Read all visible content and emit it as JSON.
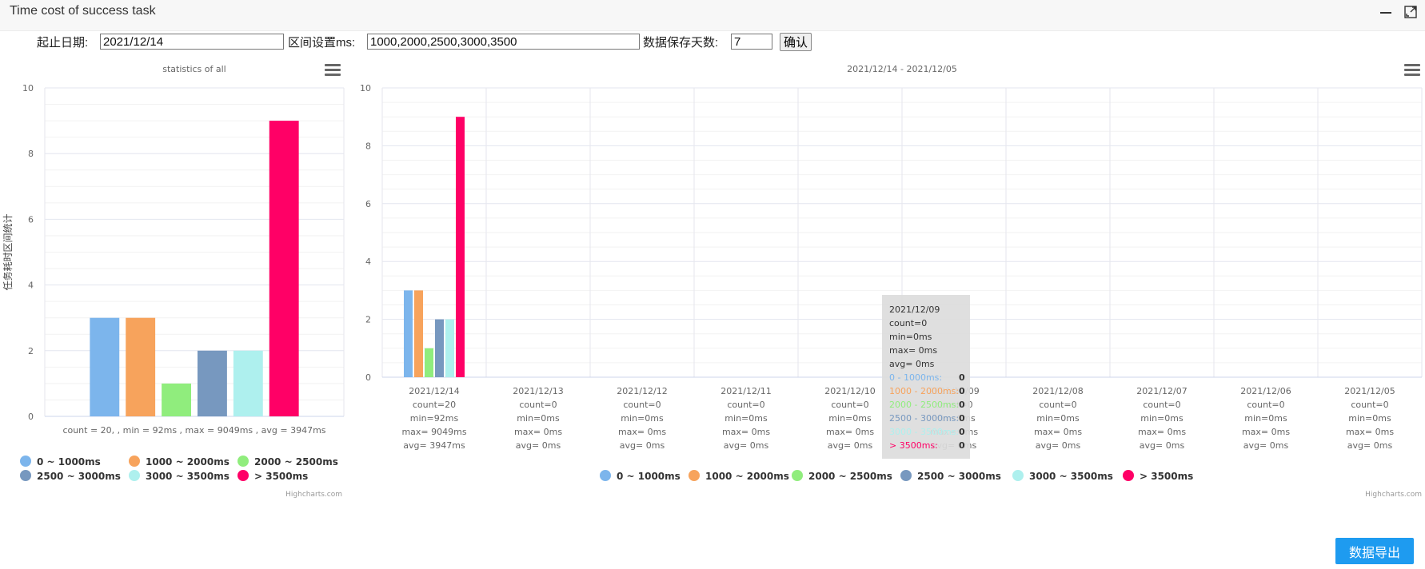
{
  "window": {
    "title": "Time cost of success task"
  },
  "filters": {
    "date_label": "起止日期:",
    "date_value": "2021/12/14",
    "interval_label": "区间设置ms:",
    "interval_value": "1000,2000,2500,3000,3500",
    "days_label": "数据保存天数:",
    "days_value": "7",
    "confirm_label": "确认"
  },
  "export_label": "数据导出",
  "colors": {
    "s0": "#7cb5ec",
    "s1": "#f7a35c",
    "s2": "#90ed7d",
    "s3": "#8085e9",
    "s4": "#aef0ee",
    "s5": "#ff0066"
  },
  "legend": [
    "0 ~ 1000ms",
    "1000 ~ 2000ms",
    "2000 ~ 2500ms",
    "2500 ~ 3000ms",
    "3000 ~ 3500ms",
    "> 3500ms"
  ],
  "credits": "Highcharts.com",
  "chart_data": [
    {
      "type": "bar",
      "title": "statistics of all",
      "ylabel": "任务耗时区间统计",
      "ylim": [
        0,
        10
      ],
      "yticks": [
        0,
        2,
        4,
        6,
        8,
        10
      ],
      "categories": [
        "count = 20, , min = 92ms , max = 9049ms , avg = 3947ms"
      ],
      "series": [
        {
          "name": "0 ~ 1000ms",
          "values": [
            3
          ]
        },
        {
          "name": "1000 ~ 2000ms",
          "values": [
            3
          ]
        },
        {
          "name": "2000 ~ 2500ms",
          "values": [
            1
          ]
        },
        {
          "name": "2500 ~ 3000ms",
          "values": [
            2
          ]
        },
        {
          "name": "3000 ~ 3500ms",
          "values": [
            2
          ]
        },
        {
          "name": "> 3500ms",
          "values": [
            9
          ]
        }
      ],
      "grid": true,
      "legend": "bottom"
    },
    {
      "type": "bar",
      "title": "2021/12/14 - 2021/12/05",
      "ylim": [
        0,
        10
      ],
      "yticks": [
        0,
        2,
        4,
        6,
        8,
        10
      ],
      "categories": [
        {
          "date": "2021/12/14",
          "count": "count=20",
          "min": "min=92ms",
          "max": "max= 9049ms",
          "avg": "avg= 3947ms"
        },
        {
          "date": "2021/12/13",
          "count": "count=0",
          "min": "min=0ms",
          "max": "max= 0ms",
          "avg": "avg= 0ms"
        },
        {
          "date": "2021/12/12",
          "count": "count=0",
          "min": "min=0ms",
          "max": "max= 0ms",
          "avg": "avg= 0ms"
        },
        {
          "date": "2021/12/11",
          "count": "count=0",
          "min": "min=0ms",
          "max": "max= 0ms",
          "avg": "avg= 0ms"
        },
        {
          "date": "2021/12/10",
          "count": "count=0",
          "min": "min=0ms",
          "max": "max= 0ms",
          "avg": "avg= 0ms"
        },
        {
          "date": "2021/12/09",
          "count": "count=0",
          "min": "min=0ms",
          "max": "max= 0ms",
          "avg": "avg= 0ms"
        },
        {
          "date": "2021/12/08",
          "count": "count=0",
          "min": "min=0ms",
          "max": "max= 0ms",
          "avg": "avg= 0ms"
        },
        {
          "date": "2021/12/07",
          "count": "count=0",
          "min": "min=0ms",
          "max": "max= 0ms",
          "avg": "avg= 0ms"
        },
        {
          "date": "2021/12/06",
          "count": "count=0",
          "min": "min=0ms",
          "max": "max= 0ms",
          "avg": "avg= 0ms"
        },
        {
          "date": "2021/12/05",
          "count": "count=0",
          "min": "min=0ms",
          "max": "max= 0ms",
          "avg": "avg= 0ms"
        }
      ],
      "series": [
        {
          "name": "0 ~ 1000ms",
          "values": [
            3,
            0,
            0,
            0,
            0,
            0,
            0,
            0,
            0,
            0
          ]
        },
        {
          "name": "1000 ~ 2000ms",
          "values": [
            3,
            0,
            0,
            0,
            0,
            0,
            0,
            0,
            0,
            0
          ]
        },
        {
          "name": "2000 ~ 2500ms",
          "values": [
            1,
            0,
            0,
            0,
            0,
            0,
            0,
            0,
            0,
            0
          ]
        },
        {
          "name": "2500 ~ 3000ms",
          "values": [
            2,
            0,
            0,
            0,
            0,
            0,
            0,
            0,
            0,
            0
          ]
        },
        {
          "name": "3000 ~ 3500ms",
          "values": [
            2,
            0,
            0,
            0,
            0,
            0,
            0,
            0,
            0,
            0
          ]
        },
        {
          "name": "> 3500ms",
          "values": [
            9,
            0,
            0,
            0,
            0,
            0,
            0,
            0,
            0,
            0
          ]
        }
      ],
      "grid": true,
      "legend": "bottom",
      "tooltip": {
        "header": "2021/12/09",
        "lines": [
          "count=0",
          "min=0ms",
          "max= 0ms",
          "avg= 0ms"
        ],
        "rows": [
          {
            "label": "0 - 1000ms:",
            "value": "0"
          },
          {
            "label": "1000 - 2000ms:",
            "value": "0"
          },
          {
            "label": "2000 - 2500ms:",
            "value": "0"
          },
          {
            "label": "2500 - 3000ms:",
            "value": "0"
          },
          {
            "label": "3000 - 3500ms:",
            "value": "0"
          },
          {
            "label": "> 3500ms:",
            "value": "0"
          }
        ]
      }
    }
  ]
}
